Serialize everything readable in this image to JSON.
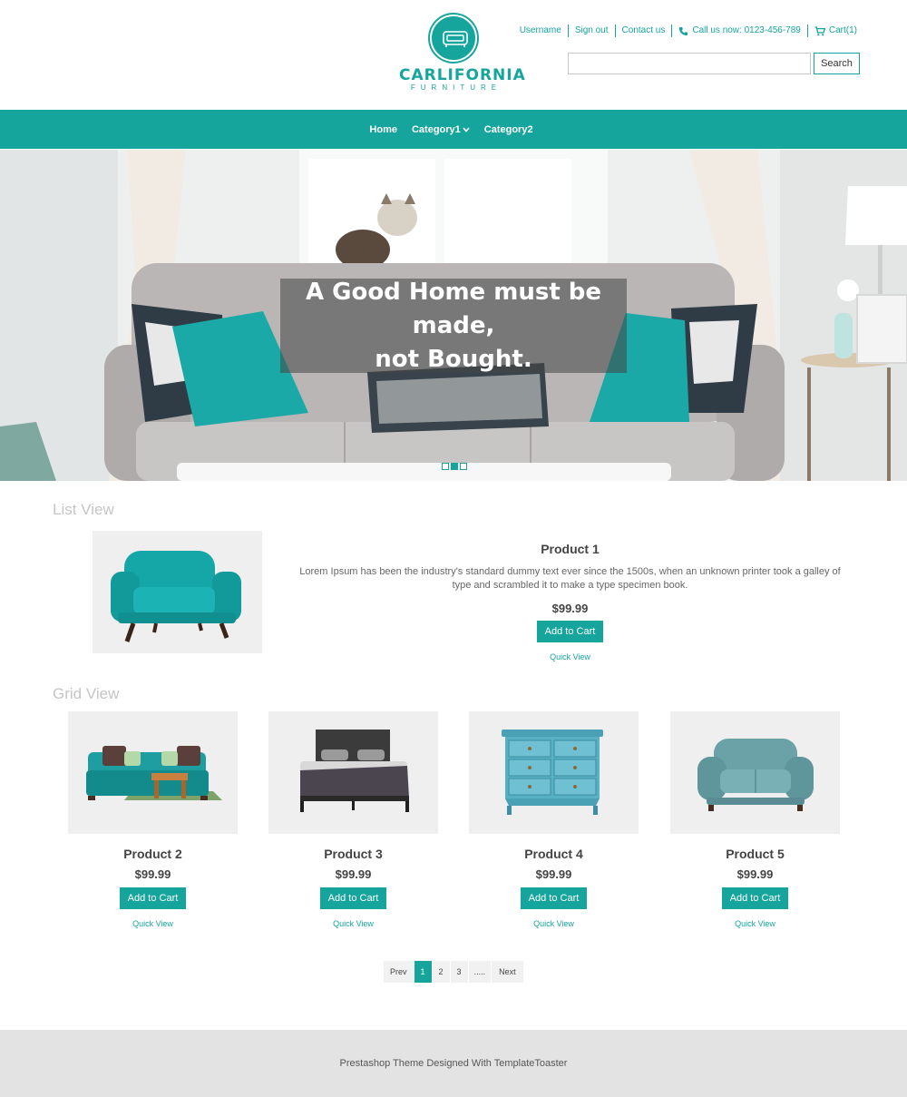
{
  "brand": {
    "name": "CARLIFORNIA",
    "tagline": "FURNITURE",
    "color": "#15a59c"
  },
  "toplinks": {
    "username": "Username",
    "signout": "Sign out",
    "contact": "Contact us",
    "call": "Call us now: 0123-456-789",
    "cart": "Cart(1)"
  },
  "search": {
    "placeholder": "",
    "button": "Search"
  },
  "nav": {
    "home": "Home",
    "category1": "Category1",
    "category2": "Category2"
  },
  "hero": {
    "line1": "A Good Home must be made,",
    "line2": "not Bought.",
    "slides": 3,
    "active_slide": 2
  },
  "list_view": {
    "title": "List View",
    "product": {
      "name": "Product 1",
      "description": "Lorem Ipsum has been the industry's standard dummy text ever since the 1500s, when an unknown printer took a galley of type and scrambled it to make a type specimen book.",
      "price": "$99.99",
      "cart": "Add to Cart",
      "quick": "Quick View"
    }
  },
  "grid_view": {
    "title": "Grid View",
    "products": [
      {
        "name": "Product 2",
        "price": "$99.99",
        "cart": "Add to Cart",
        "quick": "Quick View",
        "image": "sofa-icon"
      },
      {
        "name": "Product 3",
        "price": "$99.99",
        "cart": "Add to Cart",
        "quick": "Quick View",
        "image": "bed-icon"
      },
      {
        "name": "Product 4",
        "price": "$99.99",
        "cart": "Add to Cart",
        "quick": "Quick View",
        "image": "dresser-icon"
      },
      {
        "name": "Product 5",
        "price": "$99.99",
        "cart": "Add to Cart",
        "quick": "Quick View",
        "image": "loveseat-icon"
      }
    ]
  },
  "pagination": {
    "prev": "Prev",
    "pages": [
      "1",
      "2",
      "3",
      "....."
    ],
    "next": "Next",
    "active": "1"
  },
  "footer": {
    "text": "Prestashop Theme Designed With TemplateToaster"
  }
}
